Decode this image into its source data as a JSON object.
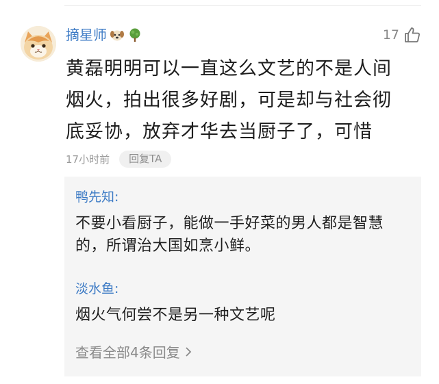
{
  "comment": {
    "username": "摘星师",
    "badges": [
      "dog-face-icon",
      "tree-icon"
    ],
    "like_count": "17",
    "like_icon": "thumbs-up-outline-icon",
    "text": "黄磊明明可以一直这么文艺的不是人间烟火，拍出很多好剧，可是却与社会彻底妥协，放弃才华去当厨子了，可惜",
    "timestamp": "17小时前",
    "reply_label": "回复TA"
  },
  "replies": [
    {
      "author": "鸭先知:",
      "text": "不要小看厨子，能做一手好菜的男人都是智慧的，所谓治大国如烹小鲜。"
    },
    {
      "author": "淡水鱼:",
      "text": "烟火气何尝不是另一种文艺呢"
    }
  ],
  "view_all_label": "查看全部4条回复",
  "colors": {
    "username": "#3d7bc5",
    "reply_bg": "#f5f5f5",
    "muted": "#9a9a9a"
  }
}
